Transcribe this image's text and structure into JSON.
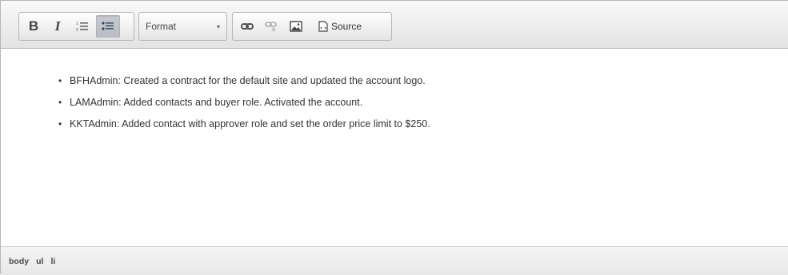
{
  "toolbar": {
    "bold_label": "B",
    "italic_label": "I",
    "format_label": "Format",
    "format_arrow": "▾",
    "source_label": "Source"
  },
  "icons": {
    "bold": "bold-icon",
    "italic": "italic-icon",
    "numbered_list": "numbered-list-icon",
    "bulleted_list": "bulleted-list-icon",
    "link": "link-icon",
    "unlink": "unlink-icon",
    "image": "image-icon",
    "source": "source-icon"
  },
  "content": {
    "items": [
      {
        "bullet": "•",
        "text": "BFHAdmin: Created a contract for the default site and updated the account logo."
      },
      {
        "bullet": "•",
        "text": "LAMAdmin: Added contacts and buyer role. Activated the account."
      },
      {
        "bullet": "•",
        "text": "KKTAdmin: Added contact with approver role and set the order price limit to $250."
      }
    ]
  },
  "statusbar": {
    "path": [
      "body",
      "ul",
      "li"
    ]
  },
  "colors": {
    "active_button": "#bfc2c8",
    "toolbar_bg": "#ececec"
  }
}
